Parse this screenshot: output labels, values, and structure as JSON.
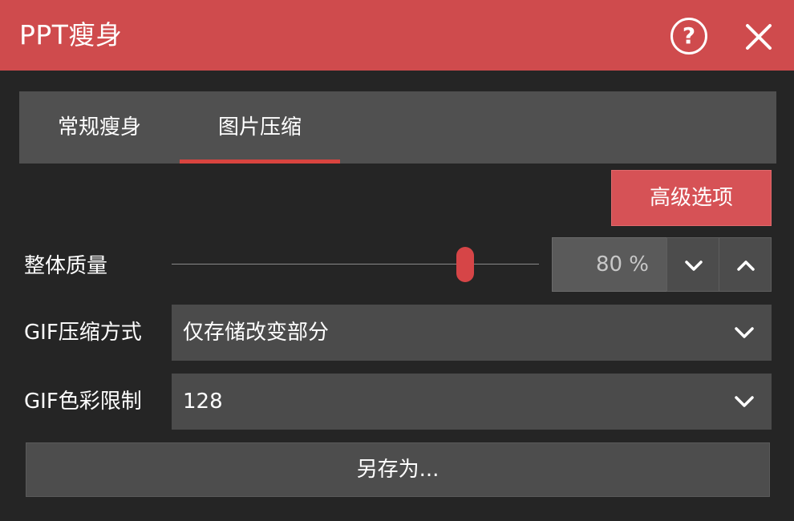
{
  "window": {
    "title": "PPT瘦身",
    "help_glyph": "?",
    "accent_color": "#cf4b4d"
  },
  "tabs": [
    {
      "label": "常规瘦身",
      "active": false
    },
    {
      "label": "图片压缩",
      "active": true
    }
  ],
  "advanced_button": {
    "label": "高级选项"
  },
  "quality": {
    "label": "整体质量",
    "value": 80,
    "display": "80 %",
    "min": 0,
    "max": 100
  },
  "gif_mode": {
    "label": "GIF压缩方式",
    "selected": "仅存储改变部分"
  },
  "gif_color": {
    "label": "GIF色彩限制",
    "selected": "128"
  },
  "save_as": {
    "label": "另存为..."
  },
  "icons": {
    "help": "question-circle-icon",
    "close": "close-icon",
    "spin_down": "chevron-down-icon",
    "spin_up": "chevron-up-icon",
    "dropdown": "chevron-down-icon"
  }
}
